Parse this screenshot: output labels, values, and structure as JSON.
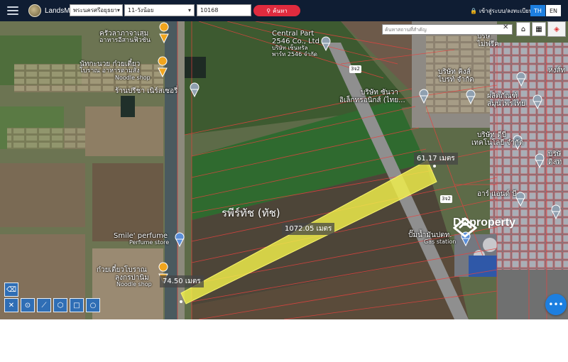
{
  "brand": {
    "name": "LandsMaps"
  },
  "filters": {
    "province": "พระนครศรีอยุธยา",
    "district": "11-วังน้อย",
    "parcel_number": "10168",
    "search_label": "ค้นหา"
  },
  "auth": {
    "login_label": "เข้าสู่ระบบ/ลงทะเบียน"
  },
  "lang": {
    "th": "TH",
    "en": "EN"
  },
  "map_search": {
    "placeholder": "ค้นหาสถานที่สำคัญ"
  },
  "parcel": {
    "name": "รพีร์ทัช (ทัช)"
  },
  "measurements": {
    "width_top": "61.17 เมตร",
    "length": "1072.05 เมตร",
    "width_bottom": "74.50 เมตร"
  },
  "pois": {
    "p1": "ครัวลาภาจาเสฺม",
    "p1b": "อาหารอีสานฟิวชั่น",
    "p2": "นัทกะนวย ก๋วยเตี๋ยว",
    "p2b": "โบราณ อาหารตามสั่ง",
    "p2c": "Noodle shop",
    "p3": "ร้านปรีชา เนิร์สเซอรี่",
    "p4": "Central Part",
    "p4b": "2546 Co., Ltd",
    "p4c": "บริษัท เซ็นทรัล",
    "p4d": "พาร์ท 2546 จำกัด",
    "p5": "บริษัท คิงส์",
    "p5b": "ไบรท์ จำกัด",
    "p6": "บริษัท ซันวา",
    "p6b": "อิเล็กทรอนิกส์ (ไทย...",
    "p7": "ผลิตภัณฑ์",
    "p7b": "สมุนไพรไทย",
    "p8": "บริษัท ดีบี",
    "p8b": "เทคโนโลยี จำกัด",
    "p9": "บริษั",
    "p9b": "ไม่ฟรีค",
    "p10": "หงส์ท",
    "p11": "บริษั",
    "p11b": "ดิสท",
    "p12": "อาร์ แอนด์ บี",
    "p13": "Smile' perfume",
    "p13b": "Perfume store",
    "p14": "ปั๊มน้ำมันปตท.",
    "p14b": "Gas station",
    "p15": "ก๋วยเตี๋ยวโบราณ",
    "p15b": "ลุงกรปานิม",
    "p15c": "Noodle shop"
  },
  "road_signs": {
    "r1": "3จ2",
    "r2": "3จ2"
  },
  "watermark": {
    "text": "DDproperty"
  },
  "colors": {
    "topbar": "#0f1d33",
    "search_button": "#e02b3e",
    "parcel_fill": "#f2f04a",
    "fab": "#1d7fe0"
  }
}
